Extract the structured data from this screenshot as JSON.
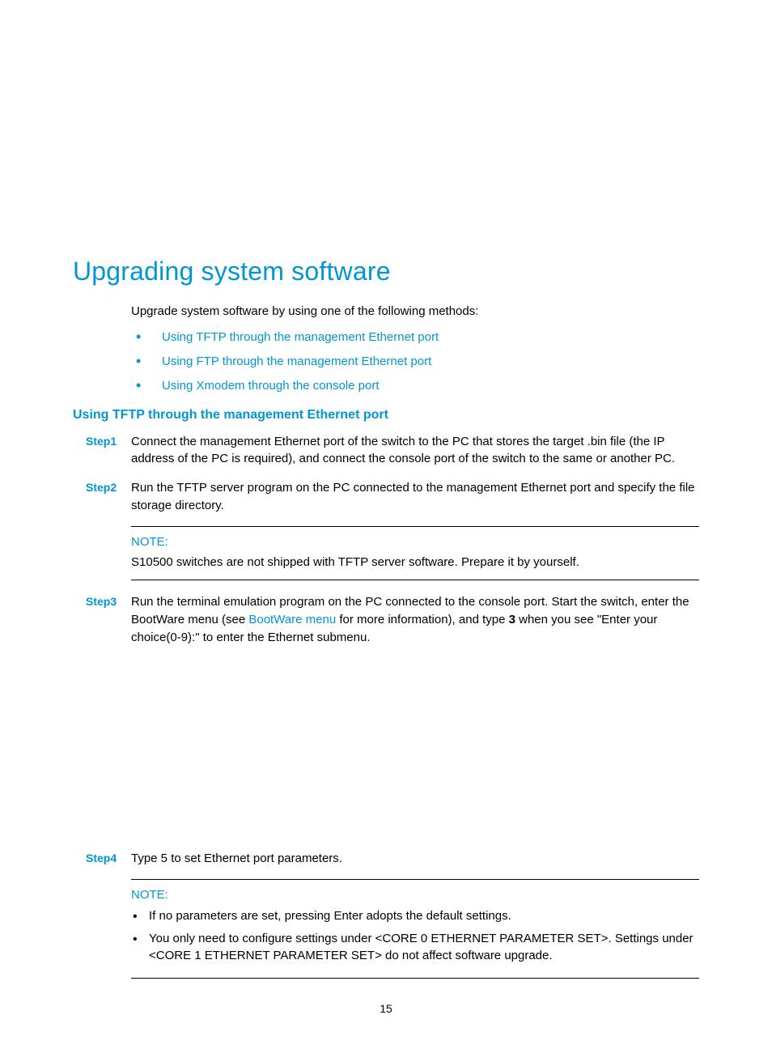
{
  "title": "Upgrading system software",
  "intro": "Upgrade system software by using one of the following methods:",
  "links": [
    "Using TFTP through the management Ethernet port",
    "Using FTP through the management Ethernet port",
    "Using Xmodem through the console port"
  ],
  "section_heading": "Using TFTP through the management Ethernet port",
  "steps": {
    "s1": {
      "label": "Step1",
      "text": "Connect the management Ethernet port of the switch to the PC that stores the target .bin file (the IP address of the PC is required), and connect the console port of the switch to the same or another PC."
    },
    "s2": {
      "label": "Step2",
      "text": "Run the TFTP server program on the PC connected to the management Ethernet port and specify the file storage directory."
    },
    "s3": {
      "label": "Step3",
      "pre": "Run the terminal emulation program on the PC connected to the console port. Start the switch, enter the BootWare menu (see ",
      "link": "BootWare menu",
      "mid": " for more information), and type ",
      "bold": "3",
      "post": " when you see \"Enter your choice(0-9):\" to enter the Ethernet submenu."
    },
    "s4": {
      "label": "Step4",
      "text": "Type 5 to set Ethernet port parameters."
    }
  },
  "note1": {
    "label": "NOTE:",
    "text": "S10500 switches are not shipped with TFTP server software. Prepare it by yourself."
  },
  "note2": {
    "label": "NOTE:",
    "items": [
      "If no parameters are set, pressing Enter adopts the default settings.",
      "You only need to configure settings under <CORE 0 ETHERNET PARAMETER SET>. Settings under <CORE 1 ETHERNET PARAMETER SET> do not affect software upgrade."
    ]
  },
  "page_number": "15"
}
